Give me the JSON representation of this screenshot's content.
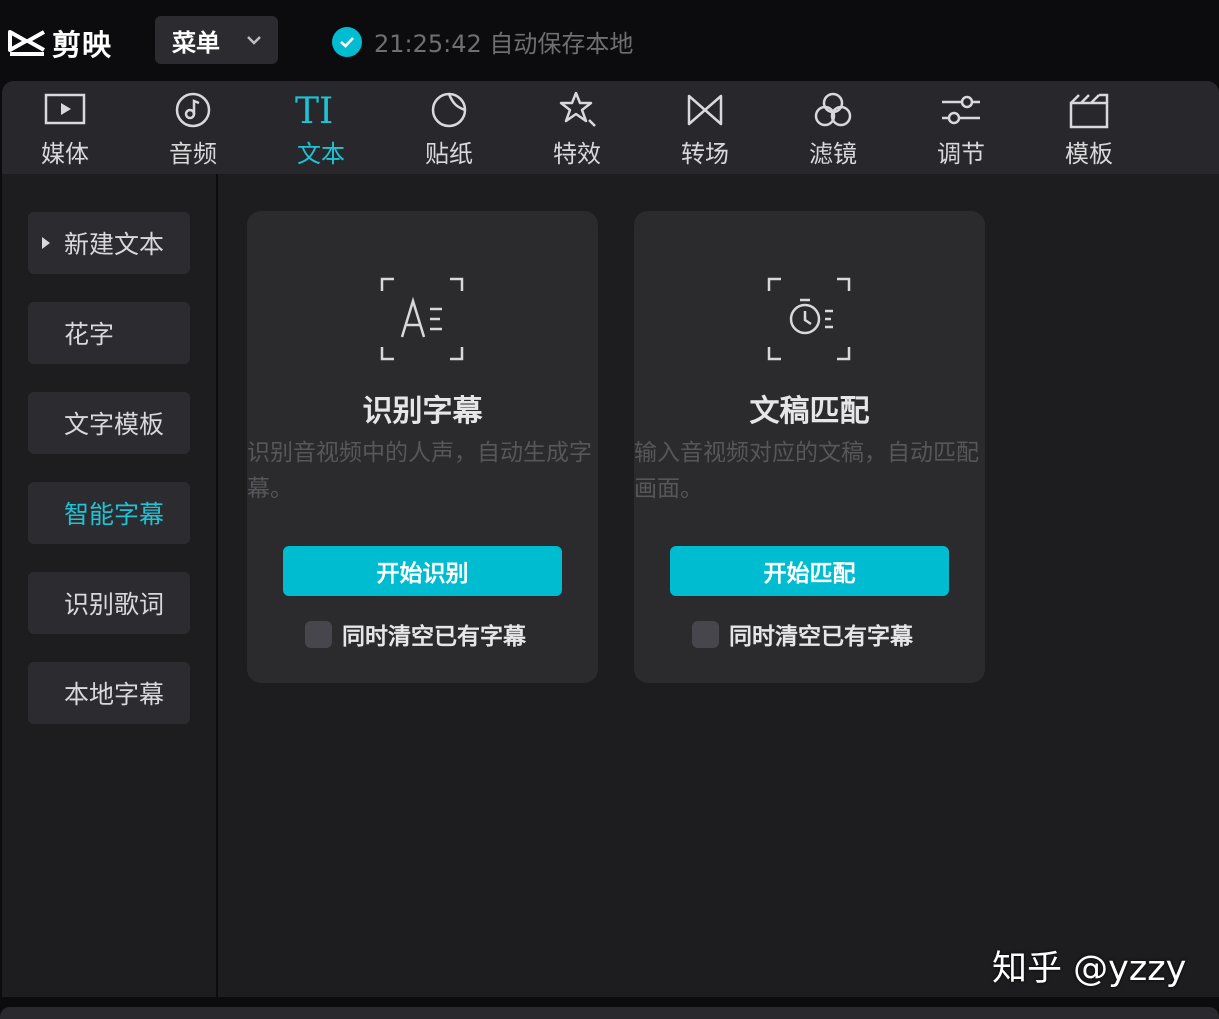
{
  "app": {
    "logo_text": "剪映",
    "menu_label": "菜单",
    "save_status": "21:25:42 自动保存本地"
  },
  "toolbar": {
    "active": "text",
    "items": [
      {
        "id": "media",
        "label": "媒体",
        "icon": "media-icon"
      },
      {
        "id": "audio",
        "label": "音频",
        "icon": "audio-icon"
      },
      {
        "id": "text",
        "label": "文本",
        "icon": "text-icon"
      },
      {
        "id": "sticker",
        "label": "贴纸",
        "icon": "sticker-icon"
      },
      {
        "id": "effects",
        "label": "特效",
        "icon": "effects-icon"
      },
      {
        "id": "transition",
        "label": "转场",
        "icon": "transition-icon"
      },
      {
        "id": "filter",
        "label": "滤镜",
        "icon": "filter-icon"
      },
      {
        "id": "adjust",
        "label": "调节",
        "icon": "adjust-icon"
      },
      {
        "id": "template",
        "label": "模板",
        "icon": "template-icon"
      }
    ]
  },
  "sidebar": {
    "active": "smart-captions",
    "items": [
      {
        "id": "new-text",
        "label": "新建文本",
        "has_caret": true
      },
      {
        "id": "fancy-text",
        "label": "花字"
      },
      {
        "id": "text-template",
        "label": "文字模板"
      },
      {
        "id": "smart-captions",
        "label": "智能字幕"
      },
      {
        "id": "recognize-lyrics",
        "label": "识别歌词"
      },
      {
        "id": "local-captions",
        "label": "本地字幕"
      }
    ]
  },
  "cards": [
    {
      "id": "recognize-captions",
      "icon": "caption-recognize-icon",
      "title": "识别字幕",
      "description": "识别音视频中的人声，自动生成字幕。",
      "button": "开始识别",
      "checkbox_label": "同时清空已有字幕",
      "checked": false
    },
    {
      "id": "script-match",
      "icon": "script-match-icon",
      "title": "文稿匹配",
      "description": "输入音视频对应的文稿，自动匹配画面。",
      "button": "开始匹配",
      "checkbox_label": "同时清空已有字幕",
      "checked": false
    }
  ],
  "watermark": "知乎 @yzzy",
  "colors": {
    "accent": "#00bcd0",
    "active_text": "#1fc3d4",
    "panel_bg": "#1d1d20",
    "toolbar_bg": "#28282c",
    "card_bg": "#2b2b2e"
  }
}
